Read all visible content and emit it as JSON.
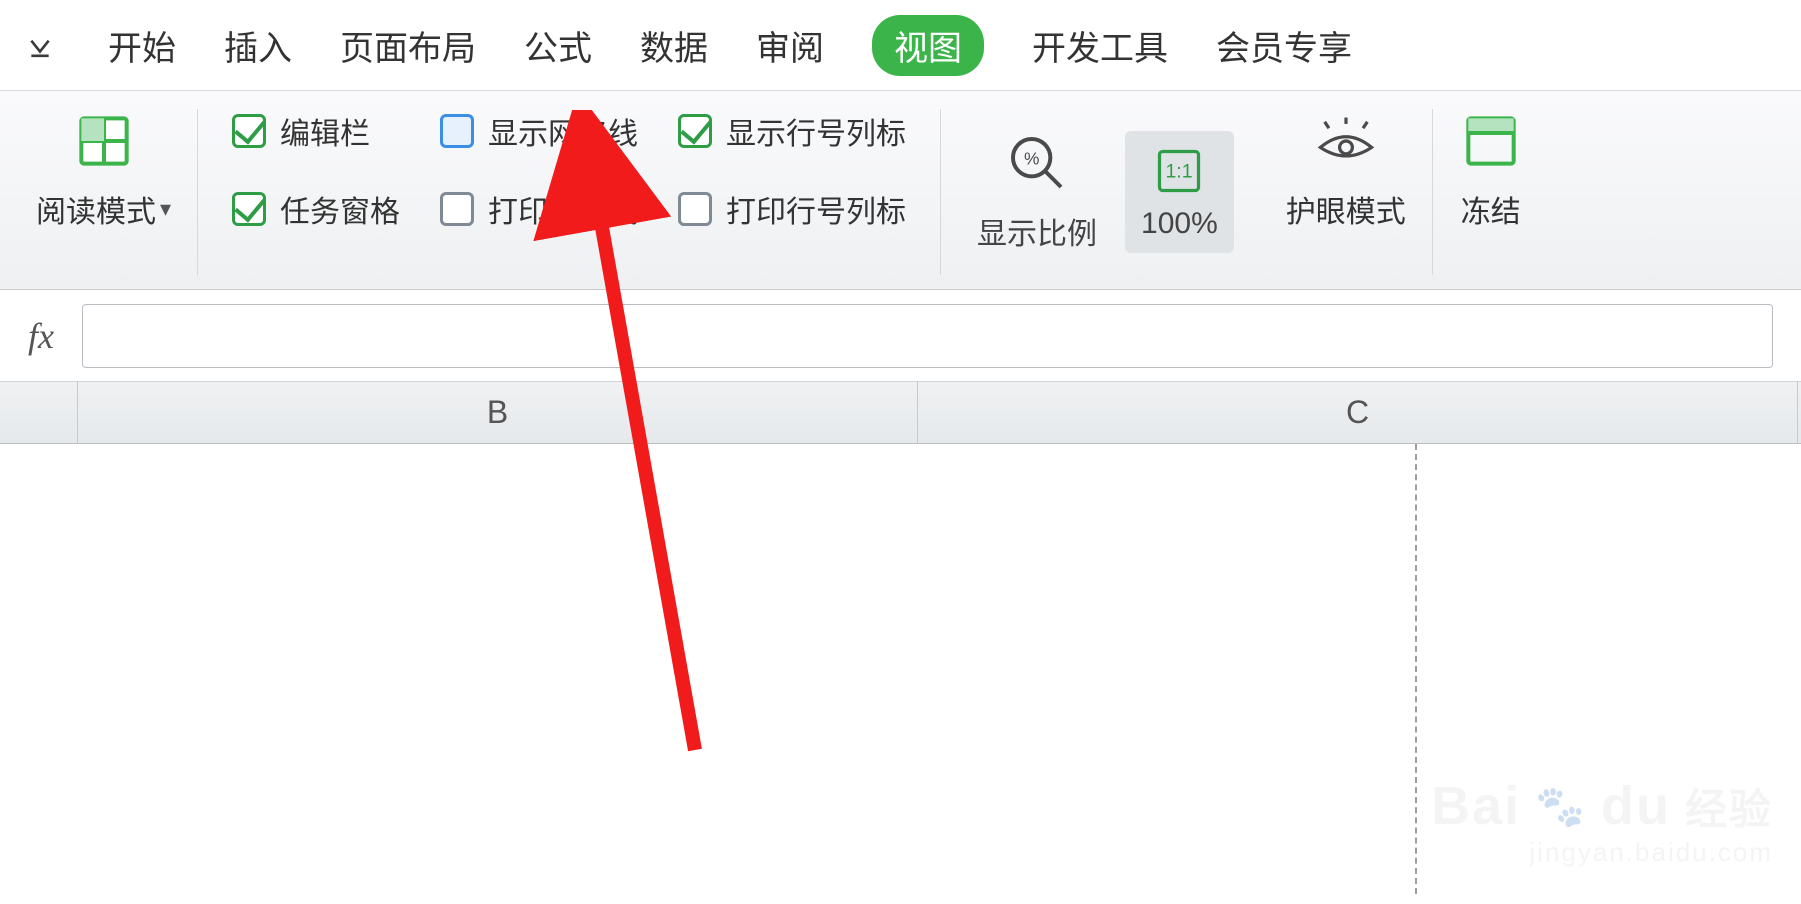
{
  "tabs": {
    "items": [
      "开始",
      "插入",
      "页面布局",
      "公式",
      "数据",
      "审阅",
      "视图",
      "开发工具",
      "会员专享"
    ],
    "active_index": 6
  },
  "ribbon": {
    "reading_mode": {
      "label": "阅读模式",
      "icon": "grid-icon"
    },
    "checks": {
      "formula_bar": {
        "label": "编辑栏",
        "checked": true
      },
      "show_grid": {
        "label": "显示网格线",
        "checked": false
      },
      "show_headers": {
        "label": "显示行号列标",
        "checked": true
      },
      "task_pane": {
        "label": "任务窗格",
        "checked": true
      },
      "print_grid": {
        "label": "打印网格线",
        "checked": false
      },
      "print_headers": {
        "label": "打印行号列标",
        "checked": false
      }
    },
    "zoom": {
      "label": "显示比例",
      "hundred": "100%"
    },
    "eye": {
      "label": "护眼模式"
    },
    "freeze": {
      "label": "冻结"
    }
  },
  "formula_bar": {
    "fx": "fx",
    "value": ""
  },
  "columns": {
    "B": "B",
    "C": "C"
  },
  "watermark": {
    "main": "Bai",
    "main2": "du",
    "caption": "经验",
    "sub": "jingyan.baidu.com"
  }
}
